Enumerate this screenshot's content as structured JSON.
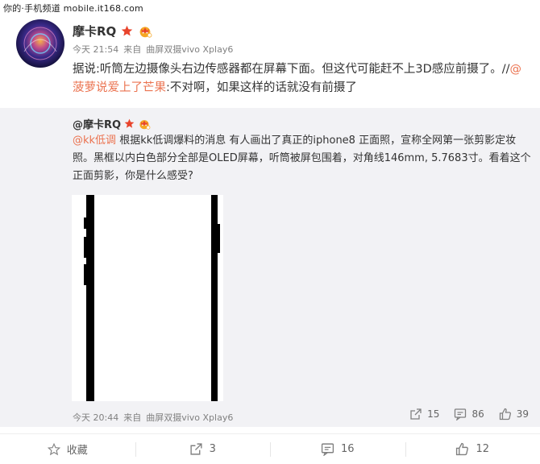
{
  "watermark": "你的·手机频道 mobile.it168.com",
  "post": {
    "author": "摩卡RQ",
    "time": "今天 21:54",
    "source_prefix": "来自",
    "source": "曲屏双摄vivo Xplay6",
    "text_part1": "据说:听筒左边摄像头右边传感器都在屏幕下面。但这代可能赶不上3D感应前摄了。//",
    "mention": "@菠萝说爱上了芒果",
    "text_part2": ":不对啊，如果这样的话就没有前摄了"
  },
  "quote": {
    "author": "@摩卡RQ",
    "mention": "@kk低调",
    "text": " 根据kk低调爆料的消息 有人画出了真正的iphone8 正面照，宣称全网第一张剪影定妆照。黑框以内白色部分全部是OLED屏幕，听筒被屏包围着，对角线146mm, 5.7683寸。看着这个正面剪影，你是什么感受?",
    "time": "今天 20:44",
    "source_prefix": "来自",
    "source": "曲屏双摄vivo Xplay6",
    "reposts": "15",
    "comments": "86",
    "likes": "39"
  },
  "bottom_bar": {
    "favorite": "收藏",
    "repost": "3",
    "comment": "16",
    "like": "12"
  },
  "icons": {
    "star_badge": "star-icon",
    "crown_badge": "crown-icon",
    "repost": "repost-icon",
    "comment": "comment-icon",
    "like": "thumbs-up-icon",
    "favorite": "star-outline-icon"
  },
  "colors": {
    "mention": "#eb7350",
    "star_badge": "#e8442c",
    "crown_badge": "#f5a623",
    "quote_bg": "#f2f2f5"
  }
}
